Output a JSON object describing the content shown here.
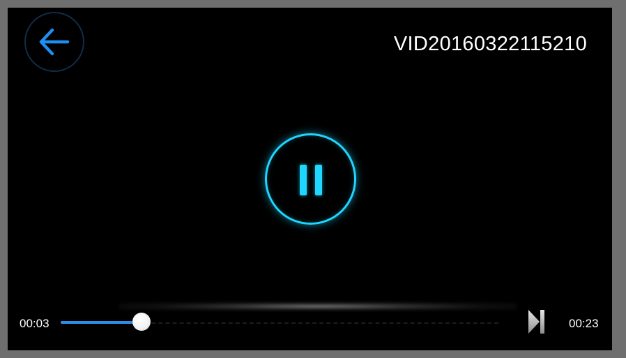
{
  "header": {
    "back_icon": "arrow-left-icon",
    "title": "VID20160322115210"
  },
  "player": {
    "state_icon": "pause-icon",
    "accent_color": "#1ed6ff"
  },
  "controls": {
    "current_time": "00:03",
    "total_time": "00:23",
    "progress_fraction": 0.185,
    "progress_color": "#2f8de8",
    "next_icon": "skip-next-icon"
  }
}
